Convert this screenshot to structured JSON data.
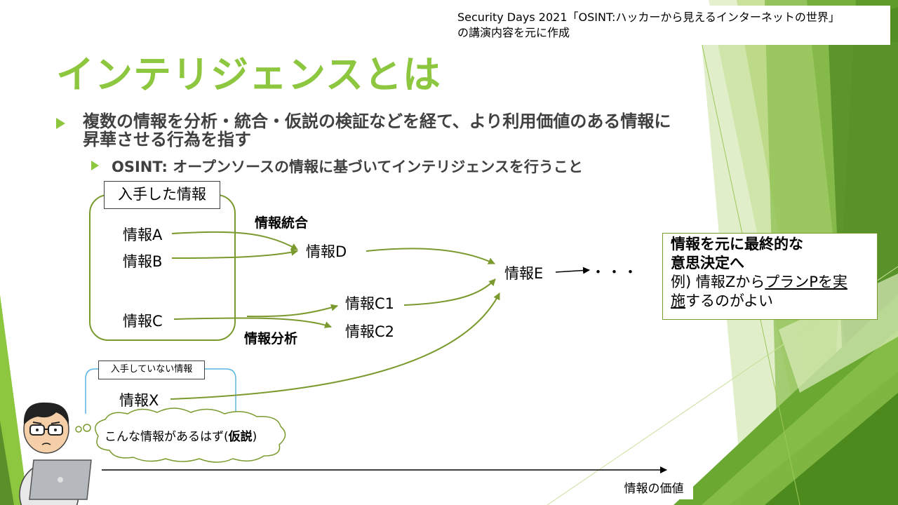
{
  "slide": {
    "title": "インテリジェンスとは",
    "source_note_line1": "Security Days 2021「OSINT:ハッカーから見えるインターネットの世界」",
    "source_note_line2": "の講演内容を元に作成",
    "bullet1_line1": "複数の情報を分析・統合・仮説の検証などを経て、より利用価値のある情報に",
    "bullet1_line2": "昇華させる行為を指す",
    "bullet2": "OSINT: オープンソースの情報に基づいてインテリジェンスを行うこと"
  },
  "diagram": {
    "obtained_label": "入手した情報",
    "not_obtained_label": "入手していない情報",
    "info_a": "情報A",
    "info_b": "情報B",
    "info_c": "情報C",
    "info_d": "情報D",
    "info_e": "情報E",
    "info_c1": "情報C1",
    "info_c2": "情報C2",
    "info_x": "情報X",
    "integration_label": "情報統合",
    "analysis_label": "情報分析",
    "ellipsis": "・・・",
    "hypothesis_prefix": "こんな情報があるはず",
    "hypothesis_open": "(",
    "hypothesis_bold": "仮説",
    "hypothesis_close": ")",
    "axis_label": "情報の価値",
    "arrow_color": "#7a9a2e"
  },
  "note": {
    "line1": "情報を元に最終的な",
    "line2": "意思決定へ",
    "example_prefix": "例) 情報Zから",
    "example_underlined1": "プランPを実",
    "example_underlined2": "施",
    "example_suffix": "するのがよい"
  },
  "colors": {
    "accent_green": "#8dc63f",
    "dark_green": "#5a8f29",
    "arrow_green": "#7a9a2e",
    "text_gray": "#404040",
    "box_blue": "#5bb4e5"
  }
}
